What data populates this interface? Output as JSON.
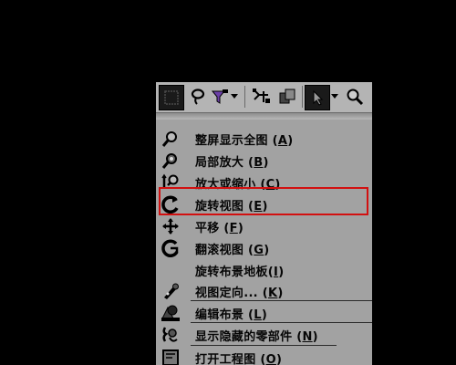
{
  "toolbar": {
    "buttons": [
      {
        "icon": "view-box-icon"
      },
      {
        "icon": "lasso-icon"
      },
      {
        "icon": "filter-icon"
      },
      {
        "icon": "dropdown-arrow-icon"
      },
      {
        "icon": "component-tree-icon"
      },
      {
        "icon": "box-view-icon"
      },
      {
        "icon": "select-cursor-icon"
      },
      {
        "icon": "dropdown-arrow-icon"
      },
      {
        "icon": "magnify-icon"
      }
    ]
  },
  "menu": {
    "items": [
      {
        "label": "整屏显示全图 (",
        "key": "A",
        "suffix": ")",
        "icon": "zoom-fit-icon"
      },
      {
        "label": "局部放大 (",
        "key": "B",
        "suffix": ")",
        "icon": "zoom-area-icon"
      },
      {
        "label": "放大或缩小 (",
        "key": "C",
        "suffix": ")",
        "icon": "zoom-inout-icon"
      },
      {
        "label": "旋转视图 (",
        "key": "E",
        "suffix": ")",
        "icon": "rotate-view-icon"
      },
      {
        "label": "平移 (",
        "key": "F",
        "suffix": ")",
        "icon": "pan-icon"
      },
      {
        "label": "翻滚视图 (",
        "key": "G",
        "suffix": ")",
        "icon": "roll-view-icon"
      },
      {
        "label": "旋转布景地板(",
        "key": "I",
        "suffix": ")",
        "icon": ""
      },
      {
        "label": "视图定向... (",
        "key": "K",
        "suffix": ")",
        "icon": "view-orientation-icon"
      },
      {
        "label": "编辑布景 (",
        "key": "L",
        "suffix": ")",
        "icon": "edit-scene-icon"
      },
      {
        "label": "显示隐藏的零部件 (",
        "key": "N",
        "suffix": ")",
        "icon": "show-hidden-components-icon"
      },
      {
        "label": "打开工程图 (",
        "key": "O",
        "suffix": ")",
        "icon": "open-drawing-icon"
      }
    ]
  },
  "colors": {
    "menu_bg": "#a2a2a2",
    "highlight_border": "#d21010",
    "background": "#000000"
  }
}
